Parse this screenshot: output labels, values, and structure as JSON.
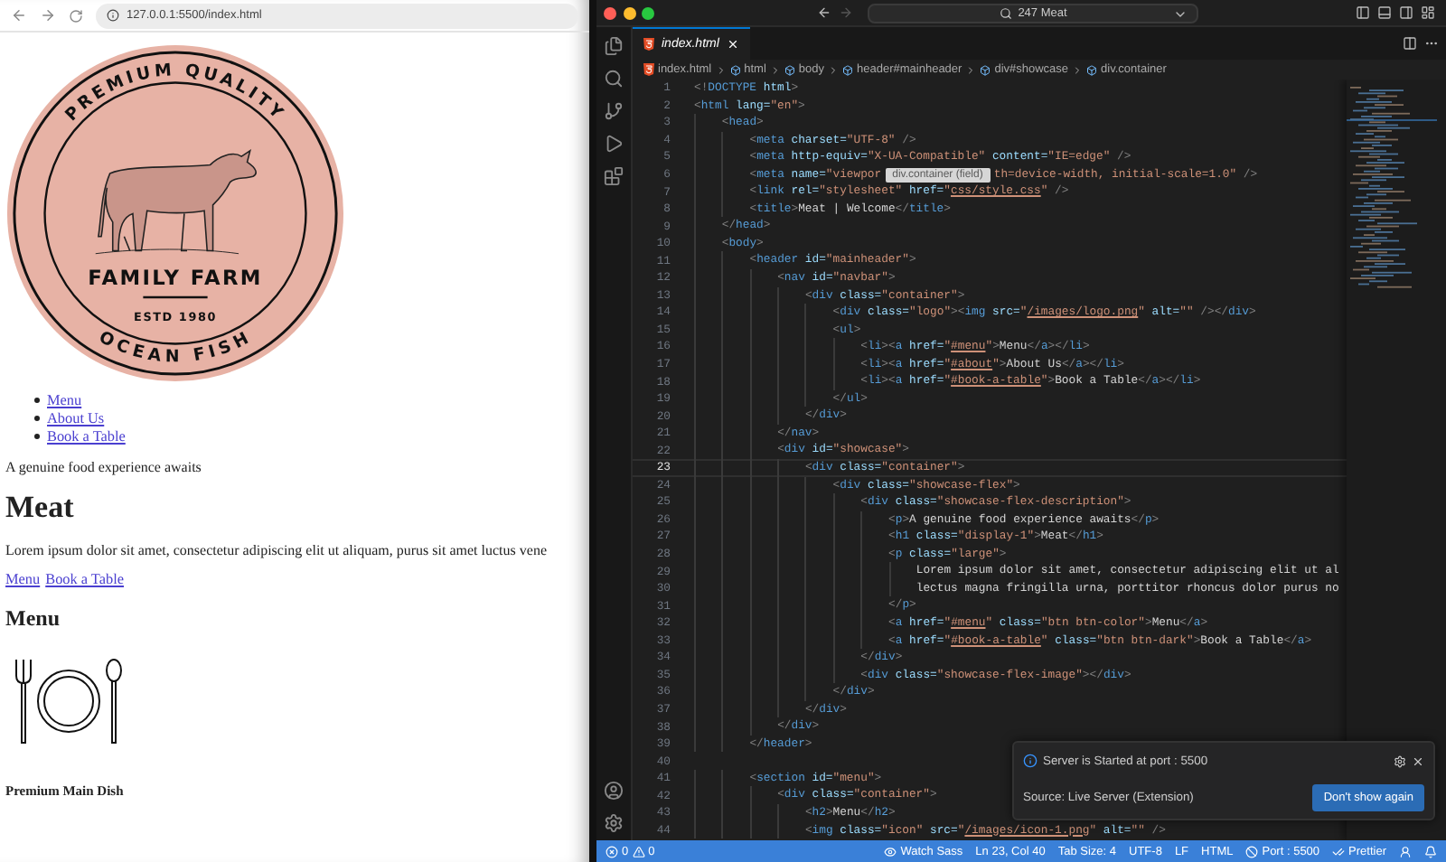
{
  "browser": {
    "url": "127.0.0.1:5500/index.html",
    "logo": {
      "top_text": "PREMIUM QUALITY",
      "title": "FAMILY FARM",
      "established": "ESTD 1980",
      "bottom_text": "OCEAN FISH"
    },
    "nav_links": [
      "Menu",
      "About Us",
      "Book a Table"
    ],
    "tagline": "A genuine food experience awaits",
    "heading": "Meat",
    "paragraph": "Lorem ipsum dolor sit amet, consectetur adipiscing elit ut aliquam, purus sit amet luctus vene",
    "buttons": [
      "Menu",
      "Book a Table"
    ],
    "section_heading": "Menu",
    "dish_title": "Premium Main Dish"
  },
  "editor": {
    "search": "247 Meat",
    "tab": {
      "label": "index.html"
    },
    "breadcrumbs": [
      {
        "kind": "file",
        "label": "index.html"
      },
      {
        "kind": "symbol",
        "label": "html"
      },
      {
        "kind": "symbol",
        "label": "body"
      },
      {
        "kind": "symbol",
        "label": "header#mainheader"
      },
      {
        "kind": "symbol",
        "label": "div#showcase"
      },
      {
        "kind": "symbol",
        "label": "div.container"
      }
    ],
    "tooltip": "div.container (field)",
    "lines": [
      {
        "number": "1",
        "current": false,
        "tokens": [
          {
            "kind": "p",
            "text": "<!"
          },
          {
            "kind": "t",
            "text": "DOCTYPE"
          },
          {
            "kind": "a",
            "text": " html"
          },
          {
            "kind": "p",
            "text": ">"
          }
        ]
      },
      {
        "number": "2",
        "current": false,
        "tokens": [
          {
            "kind": "p",
            "text": "<"
          },
          {
            "kind": "t",
            "text": "html"
          },
          {
            "kind": "a",
            "text": " lang="
          },
          {
            "kind": "s",
            "text": "\"en\""
          },
          {
            "kind": "p",
            "text": ">"
          }
        ]
      },
      {
        "number": "3",
        "current": false,
        "tokens": [
          {
            "kind": "p",
            "text": "    <"
          },
          {
            "kind": "t",
            "text": "head"
          },
          {
            "kind": "p",
            "text": ">"
          }
        ]
      },
      {
        "number": "4",
        "current": false,
        "tokens": [
          {
            "kind": "p",
            "text": "        <"
          },
          {
            "kind": "t",
            "text": "meta"
          },
          {
            "kind": "a",
            "text": " charset="
          },
          {
            "kind": "s",
            "text": "\"UTF-8\""
          },
          {
            "kind": "p",
            "text": " />"
          }
        ]
      },
      {
        "number": "5",
        "current": false,
        "tokens": [
          {
            "kind": "p",
            "text": "        <"
          },
          {
            "kind": "t",
            "text": "meta"
          },
          {
            "kind": "a",
            "text": " http-equiv="
          },
          {
            "kind": "s",
            "text": "\"X-UA-Compatible\""
          },
          {
            "kind": "a",
            "text": " content="
          },
          {
            "kind": "s",
            "text": "\"IE=edge\""
          },
          {
            "kind": "p",
            "text": " />"
          }
        ]
      },
      {
        "number": "6",
        "current": false,
        "tokens": [
          {
            "kind": "p",
            "text": "        <"
          },
          {
            "kind": "t",
            "text": "meta"
          },
          {
            "kind": "a",
            "text": " name="
          },
          {
            "kind": "s",
            "text": "\"viewpor"
          },
          {
            "kind": "gap"
          },
          {
            "kind": "s",
            "text": "th=device-width, initial-scale=1.0\""
          },
          {
            "kind": "p",
            "text": " />"
          }
        ]
      },
      {
        "number": "7",
        "current": false,
        "tokens": [
          {
            "kind": "p",
            "text": "        <"
          },
          {
            "kind": "t",
            "text": "link"
          },
          {
            "kind": "a",
            "text": " rel="
          },
          {
            "kind": "s",
            "text": "\"stylesheet\""
          },
          {
            "kind": "a",
            "text": " href="
          },
          {
            "kind": "s",
            "text": "\""
          },
          {
            "kind": "l",
            "text": "css/style.css"
          },
          {
            "kind": "s",
            "text": "\""
          },
          {
            "kind": "p",
            "text": " />"
          }
        ]
      },
      {
        "number": "8",
        "current": false,
        "tokens": [
          {
            "kind": "p",
            "text": "        <"
          },
          {
            "kind": "t",
            "text": "title"
          },
          {
            "kind": "p",
            "text": ">"
          },
          {
            "kind": "x",
            "text": "Meat | Welcome"
          },
          {
            "kind": "p",
            "text": "</"
          },
          {
            "kind": "t",
            "text": "title"
          },
          {
            "kind": "p",
            "text": ">"
          }
        ]
      },
      {
        "number": "9",
        "current": false,
        "tokens": [
          {
            "kind": "p",
            "text": "    </"
          },
          {
            "kind": "t",
            "text": "head"
          },
          {
            "kind": "p",
            "text": ">"
          }
        ]
      },
      {
        "number": "10",
        "current": false,
        "tokens": [
          {
            "kind": "p",
            "text": "    <"
          },
          {
            "kind": "t",
            "text": "body"
          },
          {
            "kind": "p",
            "text": ">"
          }
        ]
      },
      {
        "number": "11",
        "current": false,
        "tokens": [
          {
            "kind": "p",
            "text": "        <"
          },
          {
            "kind": "t",
            "text": "header"
          },
          {
            "kind": "a",
            "text": " id="
          },
          {
            "kind": "s",
            "text": "\"mainheader\""
          },
          {
            "kind": "p",
            "text": ">"
          }
        ]
      },
      {
        "number": "12",
        "current": false,
        "tokens": [
          {
            "kind": "p",
            "text": "            <"
          },
          {
            "kind": "t",
            "text": "nav"
          },
          {
            "kind": "a",
            "text": " id="
          },
          {
            "kind": "s",
            "text": "\"navbar\""
          },
          {
            "kind": "p",
            "text": ">"
          }
        ]
      },
      {
        "number": "13",
        "current": false,
        "tokens": [
          {
            "kind": "p",
            "text": "                <"
          },
          {
            "kind": "t",
            "text": "div"
          },
          {
            "kind": "a",
            "text": " class="
          },
          {
            "kind": "s",
            "text": "\"container\""
          },
          {
            "kind": "p",
            "text": ">"
          }
        ]
      },
      {
        "number": "14",
        "current": false,
        "tokens": [
          {
            "kind": "p",
            "text": "                    <"
          },
          {
            "kind": "t",
            "text": "div"
          },
          {
            "kind": "a",
            "text": " class="
          },
          {
            "kind": "s",
            "text": "\"logo\""
          },
          {
            "kind": "p",
            "text": "><"
          },
          {
            "kind": "t",
            "text": "img"
          },
          {
            "kind": "a",
            "text": " src="
          },
          {
            "kind": "s",
            "text": "\""
          },
          {
            "kind": "l",
            "text": "/images/logo.png"
          },
          {
            "kind": "s",
            "text": "\""
          },
          {
            "kind": "a",
            "text": " alt="
          },
          {
            "kind": "s",
            "text": "\"\""
          },
          {
            "kind": "p",
            "text": " /></"
          },
          {
            "kind": "t",
            "text": "div"
          },
          {
            "kind": "p",
            "text": ">"
          }
        ]
      },
      {
        "number": "15",
        "current": false,
        "tokens": [
          {
            "kind": "p",
            "text": "                    <"
          },
          {
            "kind": "t",
            "text": "ul"
          },
          {
            "kind": "p",
            "text": ">"
          }
        ]
      },
      {
        "number": "16",
        "current": false,
        "tokens": [
          {
            "kind": "p",
            "text": "                        <"
          },
          {
            "kind": "t",
            "text": "li"
          },
          {
            "kind": "p",
            "text": "><"
          },
          {
            "kind": "t",
            "text": "a"
          },
          {
            "kind": "a",
            "text": " href="
          },
          {
            "kind": "s",
            "text": "\""
          },
          {
            "kind": "l",
            "text": "#menu"
          },
          {
            "kind": "s",
            "text": "\""
          },
          {
            "kind": "p",
            "text": ">"
          },
          {
            "kind": "x",
            "text": "Menu"
          },
          {
            "kind": "p",
            "text": "</"
          },
          {
            "kind": "t",
            "text": "a"
          },
          {
            "kind": "p",
            "text": "></"
          },
          {
            "kind": "t",
            "text": "li"
          },
          {
            "kind": "p",
            "text": ">"
          }
        ]
      },
      {
        "number": "17",
        "current": false,
        "tokens": [
          {
            "kind": "p",
            "text": "                        <"
          },
          {
            "kind": "t",
            "text": "li"
          },
          {
            "kind": "p",
            "text": "><"
          },
          {
            "kind": "t",
            "text": "a"
          },
          {
            "kind": "a",
            "text": " href="
          },
          {
            "kind": "s",
            "text": "\""
          },
          {
            "kind": "l",
            "text": "#about"
          },
          {
            "kind": "s",
            "text": "\""
          },
          {
            "kind": "p",
            "text": ">"
          },
          {
            "kind": "x",
            "text": "About Us"
          },
          {
            "kind": "p",
            "text": "</"
          },
          {
            "kind": "t",
            "text": "a"
          },
          {
            "kind": "p",
            "text": "></"
          },
          {
            "kind": "t",
            "text": "li"
          },
          {
            "kind": "p",
            "text": ">"
          }
        ]
      },
      {
        "number": "18",
        "current": false,
        "tokens": [
          {
            "kind": "p",
            "text": "                        <"
          },
          {
            "kind": "t",
            "text": "li"
          },
          {
            "kind": "p",
            "text": "><"
          },
          {
            "kind": "t",
            "text": "a"
          },
          {
            "kind": "a",
            "text": " href="
          },
          {
            "kind": "s",
            "text": "\""
          },
          {
            "kind": "l",
            "text": "#book-a-table"
          },
          {
            "kind": "s",
            "text": "\""
          },
          {
            "kind": "p",
            "text": ">"
          },
          {
            "kind": "x",
            "text": "Book a Table"
          },
          {
            "kind": "p",
            "text": "</"
          },
          {
            "kind": "t",
            "text": "a"
          },
          {
            "kind": "p",
            "text": "></"
          },
          {
            "kind": "t",
            "text": "li"
          },
          {
            "kind": "p",
            "text": ">"
          }
        ]
      },
      {
        "number": "19",
        "current": false,
        "tokens": [
          {
            "kind": "p",
            "text": "                    </"
          },
          {
            "kind": "t",
            "text": "ul"
          },
          {
            "kind": "p",
            "text": ">"
          }
        ]
      },
      {
        "number": "20",
        "current": false,
        "tokens": [
          {
            "kind": "p",
            "text": "                </"
          },
          {
            "kind": "t",
            "text": "div"
          },
          {
            "kind": "p",
            "text": ">"
          }
        ]
      },
      {
        "number": "21",
        "current": false,
        "tokens": [
          {
            "kind": "p",
            "text": "            </"
          },
          {
            "kind": "t",
            "text": "nav"
          },
          {
            "kind": "p",
            "text": ">"
          }
        ]
      },
      {
        "number": "22",
        "current": false,
        "tokens": [
          {
            "kind": "p",
            "text": "            <"
          },
          {
            "kind": "t",
            "text": "div"
          },
          {
            "kind": "a",
            "text": " id="
          },
          {
            "kind": "s",
            "text": "\"showcase\""
          },
          {
            "kind": "p",
            "text": ">"
          }
        ]
      },
      {
        "number": "23",
        "current": true,
        "tokens": [
          {
            "kind": "p",
            "text": "                <"
          },
          {
            "kind": "t",
            "text": "div"
          },
          {
            "kind": "a",
            "text": " class="
          },
          {
            "kind": "s",
            "text": "\"container\""
          },
          {
            "kind": "p",
            "text": ">"
          }
        ]
      },
      {
        "number": "24",
        "current": false,
        "tokens": [
          {
            "kind": "p",
            "text": "                    <"
          },
          {
            "kind": "t",
            "text": "div"
          },
          {
            "kind": "a",
            "text": " class="
          },
          {
            "kind": "s",
            "text": "\"showcase-flex\""
          },
          {
            "kind": "p",
            "text": ">"
          }
        ]
      },
      {
        "number": "25",
        "current": false,
        "tokens": [
          {
            "kind": "p",
            "text": "                        <"
          },
          {
            "kind": "t",
            "text": "div"
          },
          {
            "kind": "a",
            "text": " class="
          },
          {
            "kind": "s",
            "text": "\"showcase-flex-description\""
          },
          {
            "kind": "p",
            "text": ">"
          }
        ]
      },
      {
        "number": "26",
        "current": false,
        "tokens": [
          {
            "kind": "p",
            "text": "                            <"
          },
          {
            "kind": "t",
            "text": "p"
          },
          {
            "kind": "p",
            "text": ">"
          },
          {
            "kind": "x",
            "text": "A genuine food experience awaits"
          },
          {
            "kind": "p",
            "text": "</"
          },
          {
            "kind": "t",
            "text": "p"
          },
          {
            "kind": "p",
            "text": ">"
          }
        ]
      },
      {
        "number": "27",
        "current": false,
        "tokens": [
          {
            "kind": "p",
            "text": "                            <"
          },
          {
            "kind": "t",
            "text": "h1"
          },
          {
            "kind": "a",
            "text": " class="
          },
          {
            "kind": "s",
            "text": "\"display-1\""
          },
          {
            "kind": "p",
            "text": ">"
          },
          {
            "kind": "x",
            "text": "Meat"
          },
          {
            "kind": "p",
            "text": "</"
          },
          {
            "kind": "t",
            "text": "h1"
          },
          {
            "kind": "p",
            "text": ">"
          }
        ]
      },
      {
        "number": "28",
        "current": false,
        "tokens": [
          {
            "kind": "p",
            "text": "                            <"
          },
          {
            "kind": "t",
            "text": "p"
          },
          {
            "kind": "a",
            "text": " class="
          },
          {
            "kind": "s",
            "text": "\"large\""
          },
          {
            "kind": "p",
            "text": ">"
          }
        ]
      },
      {
        "number": "29",
        "current": false,
        "tokens": [
          {
            "kind": "x",
            "text": "                                Lorem ipsum dolor sit amet, consectetur adipiscing elit ut al"
          }
        ]
      },
      {
        "number": "30",
        "current": false,
        "tokens": [
          {
            "kind": "x",
            "text": "                                lectus magna fringilla urna, porttitor rhoncus dolor purus no"
          }
        ]
      },
      {
        "number": "31",
        "current": false,
        "tokens": [
          {
            "kind": "p",
            "text": "                            </"
          },
          {
            "kind": "t",
            "text": "p"
          },
          {
            "kind": "p",
            "text": ">"
          }
        ]
      },
      {
        "number": "32",
        "current": false,
        "tokens": [
          {
            "kind": "p",
            "text": "                            <"
          },
          {
            "kind": "t",
            "text": "a"
          },
          {
            "kind": "a",
            "text": " href="
          },
          {
            "kind": "s",
            "text": "\""
          },
          {
            "kind": "l",
            "text": "#menu"
          },
          {
            "kind": "s",
            "text": "\""
          },
          {
            "kind": "a",
            "text": " class="
          },
          {
            "kind": "s",
            "text": "\"btn btn-color\""
          },
          {
            "kind": "p",
            "text": ">"
          },
          {
            "kind": "x",
            "text": "Menu"
          },
          {
            "kind": "p",
            "text": "</"
          },
          {
            "kind": "t",
            "text": "a"
          },
          {
            "kind": "p",
            "text": ">"
          }
        ]
      },
      {
        "number": "33",
        "current": false,
        "tokens": [
          {
            "kind": "p",
            "text": "                            <"
          },
          {
            "kind": "t",
            "text": "a"
          },
          {
            "kind": "a",
            "text": " href="
          },
          {
            "kind": "s",
            "text": "\""
          },
          {
            "kind": "l",
            "text": "#book-a-table"
          },
          {
            "kind": "s",
            "text": "\""
          },
          {
            "kind": "a",
            "text": " class="
          },
          {
            "kind": "s",
            "text": "\"btn btn-dark\""
          },
          {
            "kind": "p",
            "text": ">"
          },
          {
            "kind": "x",
            "text": "Book a Table"
          },
          {
            "kind": "p",
            "text": "</"
          },
          {
            "kind": "t",
            "text": "a"
          },
          {
            "kind": "p",
            "text": ">"
          }
        ]
      },
      {
        "number": "34",
        "current": false,
        "tokens": [
          {
            "kind": "p",
            "text": "                        </"
          },
          {
            "kind": "t",
            "text": "div"
          },
          {
            "kind": "p",
            "text": ">"
          }
        ]
      },
      {
        "number": "35",
        "current": false,
        "tokens": [
          {
            "kind": "p",
            "text": "                        <"
          },
          {
            "kind": "t",
            "text": "div"
          },
          {
            "kind": "a",
            "text": " class="
          },
          {
            "kind": "s",
            "text": "\"showcase-flex-image\""
          },
          {
            "kind": "p",
            "text": "></"
          },
          {
            "kind": "t",
            "text": "div"
          },
          {
            "kind": "p",
            "text": ">"
          }
        ]
      },
      {
        "number": "36",
        "current": false,
        "tokens": [
          {
            "kind": "p",
            "text": "                    </"
          },
          {
            "kind": "t",
            "text": "div"
          },
          {
            "kind": "p",
            "text": ">"
          }
        ]
      },
      {
        "number": "37",
        "current": false,
        "tokens": [
          {
            "kind": "p",
            "text": "                </"
          },
          {
            "kind": "t",
            "text": "div"
          },
          {
            "kind": "p",
            "text": ">"
          }
        ]
      },
      {
        "number": "38",
        "current": false,
        "tokens": [
          {
            "kind": "p",
            "text": "            </"
          },
          {
            "kind": "t",
            "text": "div"
          },
          {
            "kind": "p",
            "text": ">"
          }
        ]
      },
      {
        "number": "39",
        "current": false,
        "tokens": [
          {
            "kind": "p",
            "text": "        </"
          },
          {
            "kind": "t",
            "text": "header"
          },
          {
            "kind": "p",
            "text": ">"
          }
        ]
      },
      {
        "number": "40",
        "current": false
      },
      {
        "number": "41",
        "current": false,
        "tokens": [
          {
            "kind": "p",
            "text": "        <"
          },
          {
            "kind": "t",
            "text": "section"
          },
          {
            "kind": "a",
            "text": " id="
          },
          {
            "kind": "s",
            "text": "\"menu\""
          },
          {
            "kind": "p",
            "text": ">"
          }
        ]
      },
      {
        "number": "42",
        "current": false,
        "tokens": [
          {
            "kind": "p",
            "text": "            <"
          },
          {
            "kind": "t",
            "text": "div"
          },
          {
            "kind": "a",
            "text": " class="
          },
          {
            "kind": "s",
            "text": "\"container\""
          },
          {
            "kind": "p",
            "text": ">"
          }
        ]
      },
      {
        "number": "43",
        "current": false,
        "tokens": [
          {
            "kind": "p",
            "text": "                <"
          },
          {
            "kind": "t",
            "text": "h2"
          },
          {
            "kind": "p",
            "text": ">"
          },
          {
            "kind": "x",
            "text": "Menu"
          },
          {
            "kind": "p",
            "text": "</"
          },
          {
            "kind": "t",
            "text": "h2"
          },
          {
            "kind": "p",
            "text": ">"
          }
        ]
      },
      {
        "number": "44",
        "current": false,
        "tokens": [
          {
            "kind": "p",
            "text": "                <"
          },
          {
            "kind": "t",
            "text": "img"
          },
          {
            "kind": "a",
            "text": " class="
          },
          {
            "kind": "s",
            "text": "\"icon\""
          },
          {
            "kind": "a",
            "text": " src="
          },
          {
            "kind": "s",
            "text": "\""
          },
          {
            "kind": "l",
            "text": "/images/icon-1.png"
          },
          {
            "kind": "s",
            "text": "\""
          },
          {
            "kind": "a",
            "text": " alt="
          },
          {
            "kind": "s",
            "text": "\"\""
          },
          {
            "kind": "p",
            "text": " />"
          }
        ]
      }
    ]
  },
  "notification": {
    "message": "Server is Started at port : 5500",
    "source": "Source: Live Server (Extension)",
    "button": "Don't show again"
  },
  "status_bar": {
    "errors": "0",
    "warnings": "0",
    "items": [
      {
        "kind": "watch",
        "text": "Watch Sass"
      },
      {
        "kind": "plain",
        "text": "Ln 23, Col 40"
      },
      {
        "kind": "plain",
        "text": "Tab Size: 4"
      },
      {
        "kind": "plain",
        "text": "UTF-8"
      },
      {
        "kind": "plain",
        "text": "LF"
      },
      {
        "kind": "plain",
        "text": "HTML"
      },
      {
        "kind": "port",
        "text": "Port : 5500"
      },
      {
        "kind": "prettier",
        "text": "Prettier"
      }
    ]
  }
}
